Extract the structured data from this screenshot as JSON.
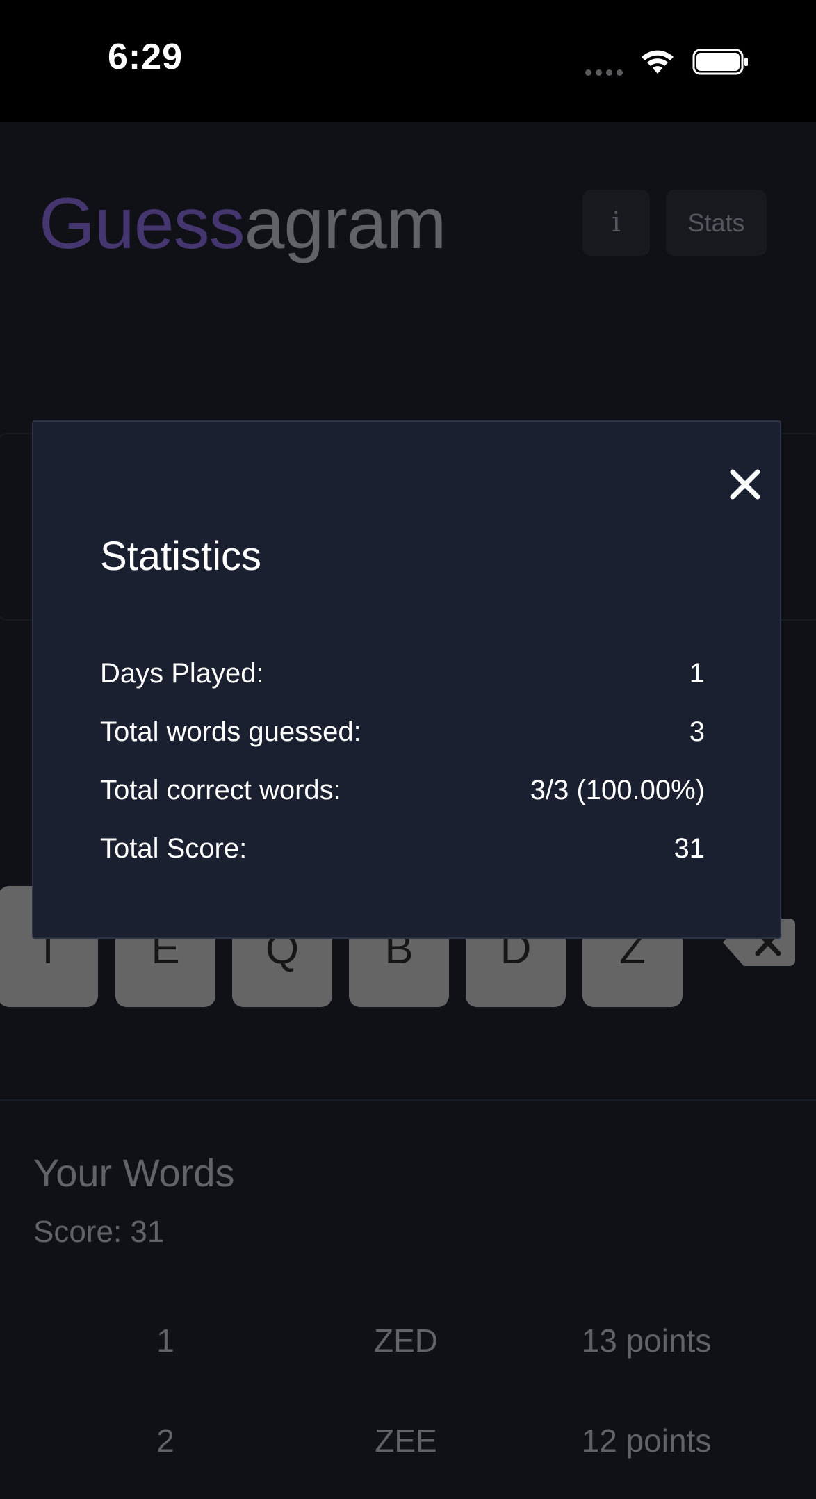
{
  "status_bar": {
    "time": "6:29",
    "signal_icon": "signal-dots-icon",
    "wifi_icon": "wifi-icon",
    "battery_icon": "battery-icon"
  },
  "header": {
    "title_part_1": "Guess",
    "title_part_2": "agram",
    "title_colors": {
      "guess": "#5a4591",
      "agram": "#7f8084"
    },
    "info_button_label": "i",
    "stats_button_label": "Stats"
  },
  "keyboard": {
    "keys": [
      "T",
      "E",
      "Q",
      "B",
      "D",
      "Z"
    ],
    "backspace_icon": "backspace-icon",
    "key_color": "#838383"
  },
  "your_words": {
    "title": "Your Words",
    "score_label": "Score: 31",
    "rows": [
      {
        "index": "1",
        "word": "ZED",
        "points": "13 points"
      },
      {
        "index": "2",
        "word": "ZEE",
        "points": "12 points"
      }
    ]
  },
  "stats_modal": {
    "title": "Statistics",
    "close_icon": "close-icon",
    "rows": [
      {
        "label": "Days Played:",
        "value": "1"
      },
      {
        "label": "Total words guessed:",
        "value": "3"
      },
      {
        "label": "Total correct words:",
        "value": "3/3 (100.00%)"
      },
      {
        "label": "Total Score:",
        "value": "31"
      }
    ],
    "background_color": "#1b2031"
  }
}
